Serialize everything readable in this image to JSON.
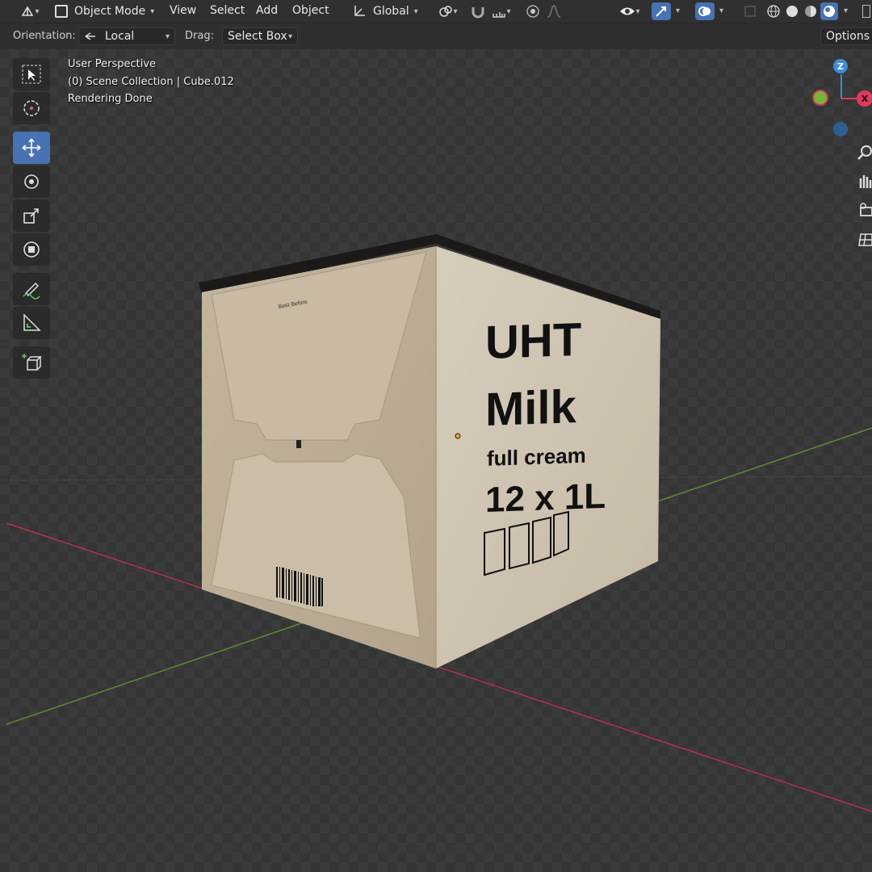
{
  "header": {
    "mode_label": "Object Mode",
    "menus": [
      "View",
      "Select",
      "Add",
      "Object"
    ],
    "transform_orientation": "Global",
    "options_label": "Options"
  },
  "toolsettings": {
    "orientation_label": "Orientation:",
    "orientation_value": "Local",
    "drag_label": "Drag:",
    "drag_value": "Select Box"
  },
  "overlay": {
    "view_name": "User Perspective",
    "collection_info": "(0) Scene Collection | Cube.012",
    "status": "Rendering Done"
  },
  "gizmo": {
    "z_label": "Z",
    "x_label": "X"
  },
  "box": {
    "front_line1": "UHT",
    "front_line2": "Milk",
    "front_line3": "full cream",
    "front_line4": "12 x 1L",
    "side_label": "Best Before"
  },
  "colors": {
    "active_tool": "#4772b3",
    "axis_x": "#e2395a",
    "axis_y": "#7ab33a",
    "axis_z": "#3b8cd9"
  }
}
